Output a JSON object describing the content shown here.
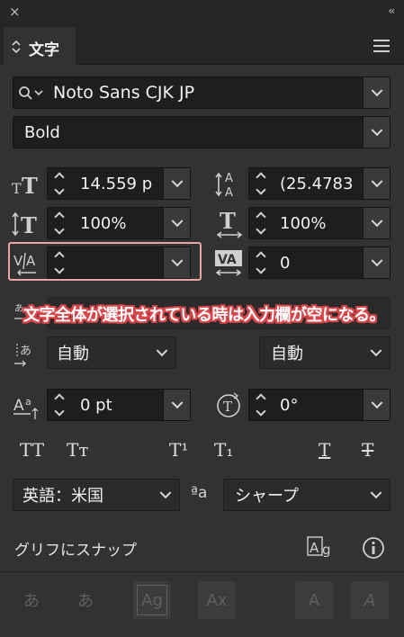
{
  "panel": {
    "close_glyph": "×",
    "collapse_glyph": "‹‹",
    "tab_label": "文字",
    "menu_icon": "hamburger-menu-icon"
  },
  "font": {
    "family_value": "Noto Sans CJK JP",
    "style_value": "Bold"
  },
  "metrics": {
    "font_size": "14.559 p",
    "leading": "(25.4783",
    "vertical_scale": "100%",
    "horizontal_scale": "100%",
    "kerning": "",
    "tracking": "0",
    "baseline_shift": "0 pt",
    "char_rotation": "0°"
  },
  "spacing": {
    "aki_left": "自動",
    "aki_right": "自動"
  },
  "annotation": "文字全体が選択されている時は入力欄が空になる。",
  "text_buttons": [
    "TT",
    "Tт",
    "T¹",
    "T₁",
    "T",
    "T"
  ],
  "language": {
    "value": "英語：米国",
    "aa_label": "ªa",
    "antialias_value": "シャープ"
  },
  "snap": {
    "label": "グリフにスナップ"
  },
  "bottom_icons": [
    "あ",
    "あ",
    "Ag",
    "Ax",
    "A",
    "A"
  ]
}
